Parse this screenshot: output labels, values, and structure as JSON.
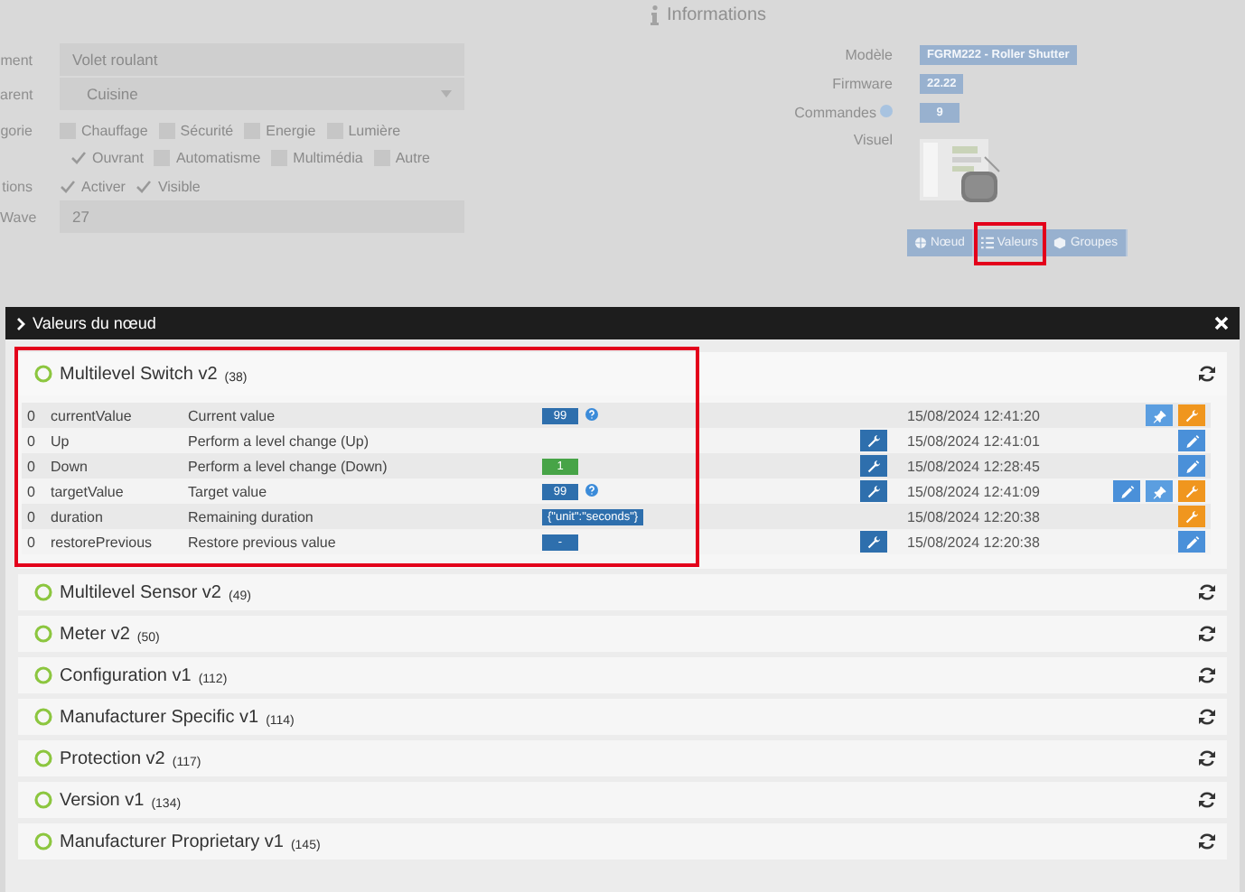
{
  "form": {
    "name_label": "ment",
    "name_value": "Volet roulant",
    "parent_label": "arent",
    "parent_value": "Cuisine",
    "category_label": "gorie",
    "category_rows": [
      [
        {
          "label": "Chauffage",
          "checked": false
        },
        {
          "label": "Sécurité",
          "checked": false
        },
        {
          "label": "Energie",
          "checked": false
        },
        {
          "label": "Lumière",
          "checked": false
        }
      ],
      [
        {
          "label": "Ouvrant",
          "checked": true
        },
        {
          "label": "Automatisme",
          "checked": false
        },
        {
          "label": "Multimédia",
          "checked": false
        },
        {
          "label": "Autre",
          "checked": false
        }
      ]
    ],
    "options_label": "tions",
    "options": [
      {
        "label": "Activer",
        "checked": true
      },
      {
        "label": "Visible",
        "checked": true
      }
    ],
    "wave_label": "Wave",
    "wave_value": "27"
  },
  "info": {
    "title": "Informations",
    "rows": [
      {
        "label": "Modèle",
        "value": "FGRM222 - Roller Shutter",
        "help": false
      },
      {
        "label": "Firmware",
        "value": "22.22",
        "help": false
      },
      {
        "label": "Commandes",
        "value": "9",
        "help": true
      }
    ],
    "visual_label": "Visuel",
    "buttons": [
      {
        "label": "Nœud",
        "kind": "node",
        "highlighted": false
      },
      {
        "label": "Valeurs",
        "kind": "list",
        "highlighted": true
      },
      {
        "label": "Groupes",
        "kind": "group",
        "highlighted": false
      }
    ]
  },
  "modal": {
    "title": "Valeurs du nœud",
    "panels": [
      {
        "name": "Multilevel Switch v2",
        "count": "(38)",
        "expanded": true,
        "highlighted": true,
        "rows": [
          {
            "index": "0",
            "name": "currentValue",
            "description": "Current value",
            "value": {
              "kind": "blue",
              "text": "99"
            },
            "help": true,
            "wrench": false,
            "date": "15/08/2024 12:41:20",
            "actions": [
              {
                "kind": "pin"
              },
              {
                "kind": "configure"
              }
            ]
          },
          {
            "index": "0",
            "name": "Up",
            "description": "Perform a level change (Up)",
            "help": false,
            "wrench": true,
            "date": "15/08/2024 12:41:01",
            "actions": [
              {
                "kind": "edit"
              }
            ]
          },
          {
            "index": "0",
            "name": "Down",
            "description": "Perform a level change (Down)",
            "value": {
              "kind": "green",
              "text": "1"
            },
            "help": false,
            "wrench": true,
            "date": "15/08/2024 12:28:45",
            "actions": [
              {
                "kind": "edit"
              }
            ]
          },
          {
            "index": "0",
            "name": "targetValue",
            "description": "Target value",
            "value": {
              "kind": "blue",
              "text": "99"
            },
            "help": true,
            "wrench": true,
            "date": "15/08/2024 12:41:09",
            "actions": [
              {
                "kind": "edit"
              },
              {
                "kind": "pin"
              },
              {
                "kind": "configure"
              }
            ]
          },
          {
            "index": "0",
            "name": "duration",
            "description": "Remaining duration",
            "value": {
              "kind": "blue",
              "text": "{\"unit\":\"seconds\"}"
            },
            "help": false,
            "wrench": false,
            "date": "15/08/2024 12:20:38",
            "actions": [
              {
                "kind": "configure"
              }
            ]
          },
          {
            "index": "0",
            "name": "restorePrevious",
            "description": "Restore previous value",
            "value": {
              "kind": "blue",
              "text": "-"
            },
            "help": false,
            "wrench": true,
            "date": "15/08/2024 12:20:38",
            "actions": [
              {
                "kind": "edit"
              }
            ]
          }
        ]
      },
      {
        "name": "Multilevel Sensor v2",
        "count": "(49)",
        "expanded": false,
        "highlighted": false
      },
      {
        "name": "Meter v2",
        "count": "(50)",
        "expanded": false,
        "highlighted": false
      },
      {
        "name": "Configuration v1",
        "count": "(112)",
        "expanded": false,
        "highlighted": false
      },
      {
        "name": "Manufacturer Specific v1",
        "count": "(114)",
        "expanded": false,
        "highlighted": false
      },
      {
        "name": "Protection v2",
        "count": "(117)",
        "expanded": false,
        "highlighted": false
      },
      {
        "name": "Version v1",
        "count": "(134)",
        "expanded": false,
        "highlighted": false
      },
      {
        "name": "Manufacturer Proprietary v1",
        "count": "(145)",
        "expanded": false,
        "highlighted": false
      }
    ]
  }
}
